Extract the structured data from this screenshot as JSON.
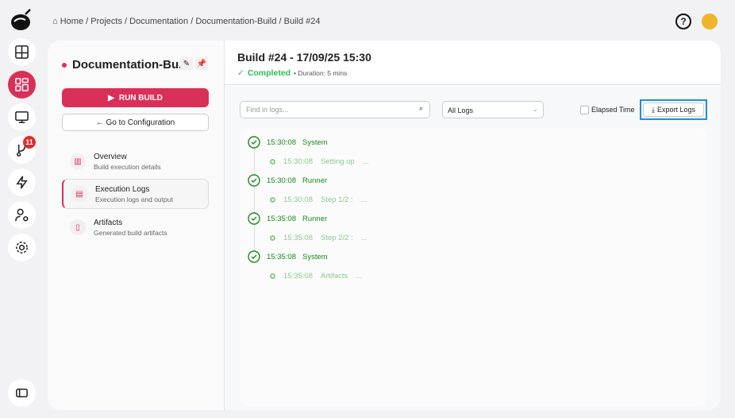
{
  "breadcrumb": {
    "items": [
      "Home",
      "Projects",
      "Documentation",
      "Documentation-Build",
      "Build #24"
    ]
  },
  "rail": {
    "notifications_badge": "11"
  },
  "pipeline": {
    "title": "Documentation-Bu...",
    "run_label": "RUN BUILD",
    "config_label": "← Go to Configuration"
  },
  "nav": [
    {
      "title": "Overview",
      "subtitle": "Build execution details"
    },
    {
      "title": "Execution Logs",
      "subtitle": "Execution logs and output"
    },
    {
      "title": "Artifacts",
      "subtitle": "Generated build artifacts"
    }
  ],
  "build": {
    "title": "Build #24 - 17/09/25 15:30",
    "status": "Completed",
    "duration": "• Duration: 5 mins"
  },
  "toolbar": {
    "search_placeholder": "Find in logs...",
    "filter_value": "All Logs",
    "elapsed_label": "Elapsed Time",
    "export_label": "Export Logs"
  },
  "logs": [
    {
      "time": "15:30:08",
      "source": "System",
      "step_time": "15:30:08",
      "step": "Setting up",
      "more": "..."
    },
    {
      "time": "15:30:08",
      "source": "Runner",
      "step_time": "15:30:08",
      "step": "Step 1/2 :",
      "more": "..."
    },
    {
      "time": "15:35:08",
      "source": "Runner",
      "step_time": "15:35:08",
      "step": "Step 2/2 :",
      "more": "..."
    },
    {
      "time": "15:35:08",
      "source": "System",
      "step_time": "15:35:08",
      "step": "Artifacts",
      "more": "..."
    }
  ],
  "colors": {
    "accent": "#d93058",
    "success": "#1a8a1a",
    "focus": "#1e8fe0"
  }
}
